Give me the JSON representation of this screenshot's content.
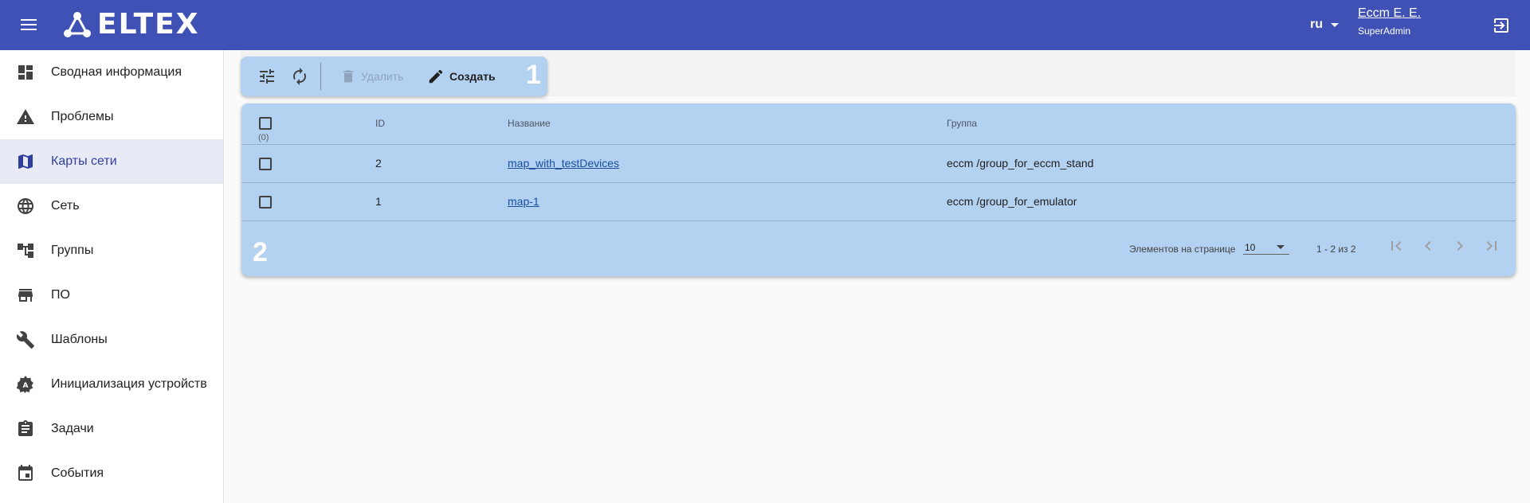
{
  "header": {
    "logo_text": "ELTEX",
    "language": "ru",
    "user_name": "Eccm E. E.",
    "user_role": "SuperAdmin"
  },
  "sidebar": {
    "items": [
      {
        "label": "Сводная информация",
        "icon": "dashboard-icon"
      },
      {
        "label": "Проблемы",
        "icon": "warning-icon"
      },
      {
        "label": "Карты сети",
        "icon": "map-icon",
        "active": true
      },
      {
        "label": "Сеть",
        "icon": "globe-icon"
      },
      {
        "label": "Группы",
        "icon": "tree-icon"
      },
      {
        "label": "ПО",
        "icon": "store-icon"
      },
      {
        "label": "Шаблоны",
        "icon": "wrench-icon"
      },
      {
        "label": "Инициализация устройств",
        "icon": "settings-a-icon"
      },
      {
        "label": "Задачи",
        "icon": "clipboard-icon"
      },
      {
        "label": "События",
        "icon": "calendar-icon"
      }
    ]
  },
  "toolbar": {
    "delete_label": "Удалить",
    "create_label": "Создать",
    "marker": "1"
  },
  "table": {
    "columns": [
      "ID",
      "Название",
      "Группа"
    ],
    "selected_count": "(0)",
    "rows": [
      {
        "id": "2",
        "name": "map_with_testDevices",
        "group": "eccm /group_for_eccm_stand"
      },
      {
        "id": "1",
        "name": "map-1",
        "group": "eccm /group_for_emulator"
      }
    ],
    "marker": "2"
  },
  "pagination": {
    "per_page_label": "Элементов на странице",
    "per_page_value": "10",
    "range": "1 - 2 из 2"
  },
  "colors": {
    "header_bg": "#3f51b5",
    "highlight_bg": "#b3d1f0",
    "active_nav_bg": "#e8eaf6"
  }
}
